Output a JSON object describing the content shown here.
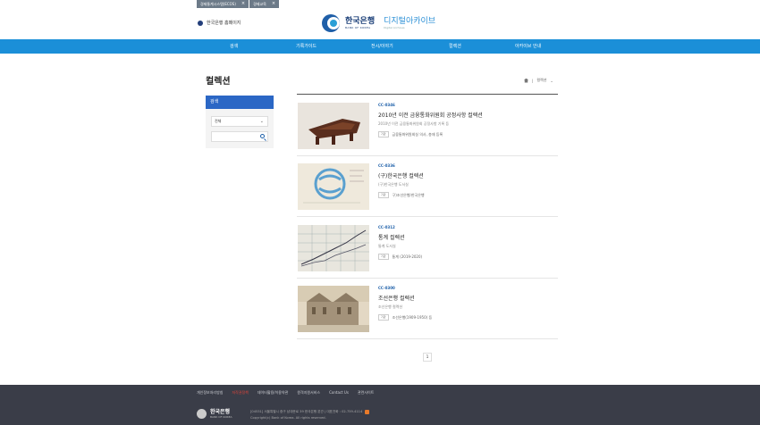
{
  "top_tabs": [
    {
      "label": "경제통계시스템(ECOS)",
      "close": "×"
    },
    {
      "label": "경제교육",
      "close": "×"
    }
  ],
  "header": {
    "home_link": "한국은행 홈페이지",
    "logo_ko": "한국은행",
    "logo_en": "BANK OF KOREA",
    "archive_title": "디지털아카이브",
    "archive_sub": "Digital Archives"
  },
  "nav": [
    "검색",
    "기록가이드",
    "전시/이야기",
    "컬렉션",
    "아카이브 안내"
  ],
  "page": {
    "title": "컬렉션",
    "breadcrumb_current": "컬렉션",
    "breadcrumb_chevron": "⌄"
  },
  "sidebar": {
    "head": "검색",
    "select_value": "전체",
    "select_chevron": "⌄",
    "search_placeholder": ""
  },
  "items": [
    {
      "code": "CC-0346",
      "title": "2010년 이전 금융통화위원회 공정사항 컬렉션",
      "sub": "2010년 이전 금융통화위원회 공정사항 기록 등",
      "tag_label": "기관",
      "tag_value": "금융통화위원회실 의사, 총재 등록"
    },
    {
      "code": "CC-0336",
      "title": "(구)한국은행 컬렉션",
      "sub": "(구)한국은행 도서실",
      "tag_label": "기관",
      "tag_value": "구)조선은행/한국은행"
    },
    {
      "code": "CC-0312",
      "title": "통계 컬렉션",
      "sub": "통계 도서실",
      "tag_label": "기관",
      "tag_value": "통계 (2019-2020)"
    },
    {
      "code": "CC-0300",
      "title": "조선은행 컬렉션",
      "sub": "조선은행 컬렉션",
      "tag_label": "기관",
      "tag_value": "조선은행(1909-1950) 등"
    }
  ],
  "pager": {
    "current": "1"
  },
  "footer": {
    "links": [
      "개인정보처리방침",
      "저작권정책",
      "데이터활용/이용약관",
      "원격지원서비스",
      "Contact Us",
      "관련사이트"
    ],
    "highlight_index": 1,
    "logo_ko": "한국은행",
    "logo_en": "BANK OF KOREA",
    "address": "[04531] 서울특별시 중구 남대문로 39 한국은행 본관 | 대표전화 : 02-759-4114",
    "copyright": "Copyright(c) Bank of Korea. All rights reserved."
  }
}
